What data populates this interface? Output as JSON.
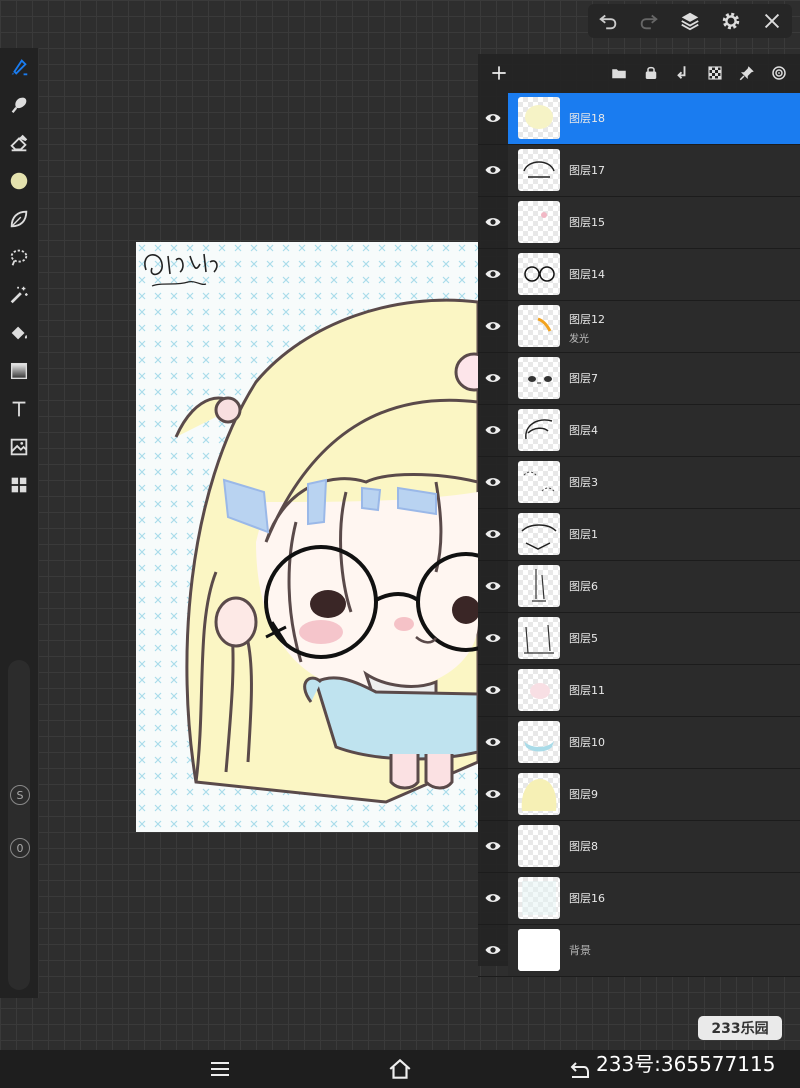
{
  "colors": {
    "accent": "#1a7cf0",
    "panel": "#242424",
    "workspace": "#2e2e2e",
    "current_color": "#e4e2ae"
  },
  "top_toolbar": {
    "icons": [
      "undo-icon",
      "redo-icon",
      "layers-icon",
      "settings-icon",
      "close-icon"
    ]
  },
  "left_toolbar": {
    "tools": [
      "brush-icon",
      "smudge-icon",
      "eraser-icon",
      "color-swatch",
      "leaf-brush-icon",
      "lasso-icon",
      "magic-wand-icon",
      "paint-bucket-icon",
      "gradient-icon",
      "text-icon",
      "image-adjust-icon",
      "grid-icon"
    ],
    "size_label": "S",
    "opacity_label": "0"
  },
  "layers_panel": {
    "add_icon": "plus-icon",
    "actions": [
      "folder-icon",
      "lock-icon",
      "merge-down-icon",
      "transparency-icon",
      "pin-icon",
      "target-icon"
    ],
    "layers": [
      {
        "name": "图层18",
        "selected": true
      },
      {
        "name": "图层17"
      },
      {
        "name": "图层15"
      },
      {
        "name": "图层14"
      },
      {
        "name": "图层12",
        "sub": "发光"
      },
      {
        "name": "图层7"
      },
      {
        "name": "图层4"
      },
      {
        "name": "图层3"
      },
      {
        "name": "图层1"
      },
      {
        "name": "图层6"
      },
      {
        "name": "图层5"
      },
      {
        "name": "图层11"
      },
      {
        "name": "图层10"
      },
      {
        "name": "图层9"
      },
      {
        "name": "图层8"
      },
      {
        "name": "图层16"
      },
      {
        "name": "背景"
      }
    ]
  },
  "watermark": {
    "logo": "233乐园",
    "id_text": "233号:365577115"
  },
  "bottom_nav": {
    "icons": [
      "menu-icon",
      "home-icon",
      "back-icon"
    ]
  }
}
